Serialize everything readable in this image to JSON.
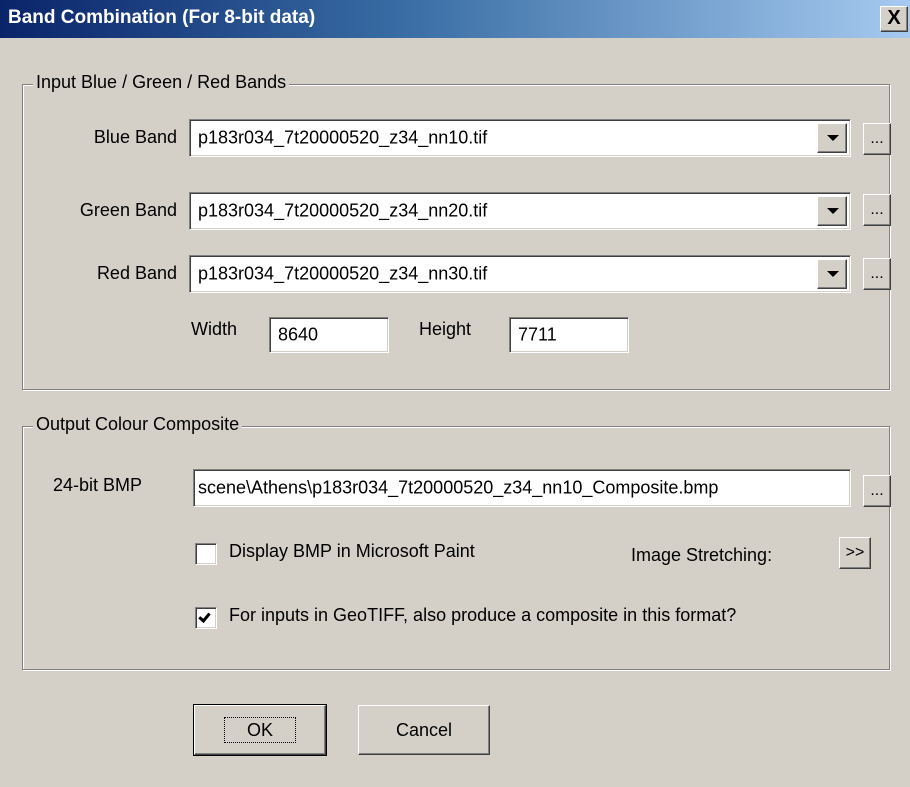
{
  "window": {
    "title": "Band Combination (For 8-bit data)",
    "close_glyph": "X"
  },
  "input_group": {
    "legend": "Input Blue / Green / Red Bands",
    "bands": [
      {
        "label": "Blue Band",
        "value": "p183r034_7t20000520_z34_nn10.tif",
        "browse_label": "..."
      },
      {
        "label": "Green Band",
        "value": "p183r034_7t20000520_z34_nn20.tif",
        "browse_label": "..."
      },
      {
        "label": "Red Band",
        "value": "p183r034_7t20000520_z34_nn30.tif",
        "browse_label": "..."
      }
    ],
    "width_label": "Width",
    "width_value": "8640",
    "height_label": "Height",
    "height_value": "7711"
  },
  "output_group": {
    "legend": "Output Colour Composite",
    "bmp_label": "24-bit BMP",
    "bmp_value": "scene\\Athens\\p183r034_7t20000520_z34_nn10_Composite.bmp",
    "bmp_browse_label": "...",
    "display_paint_label": "Display BMP in Microsoft Paint",
    "display_paint_checked": false,
    "stretching_label": "Image Stretching:",
    "stretching_button_label": ">>",
    "geotiff_label": "For inputs in GeoTIFF, also produce a composite in this format?",
    "geotiff_checked": true
  },
  "buttons": {
    "ok_label": "OK",
    "cancel_label": "Cancel"
  }
}
